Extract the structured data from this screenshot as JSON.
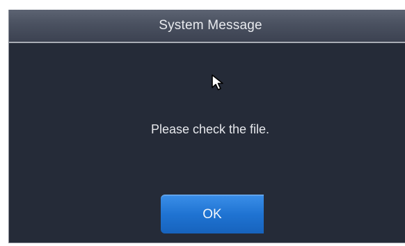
{
  "dialog": {
    "title": "System Message",
    "message": "Please check the file.",
    "ok_label": "OK"
  },
  "colors": {
    "dialog_background": "#252b38",
    "title_bar": "#4a5160",
    "ok_button": "#1f73d2"
  },
  "icons": {
    "cursor": "mouse-pointer-icon"
  }
}
